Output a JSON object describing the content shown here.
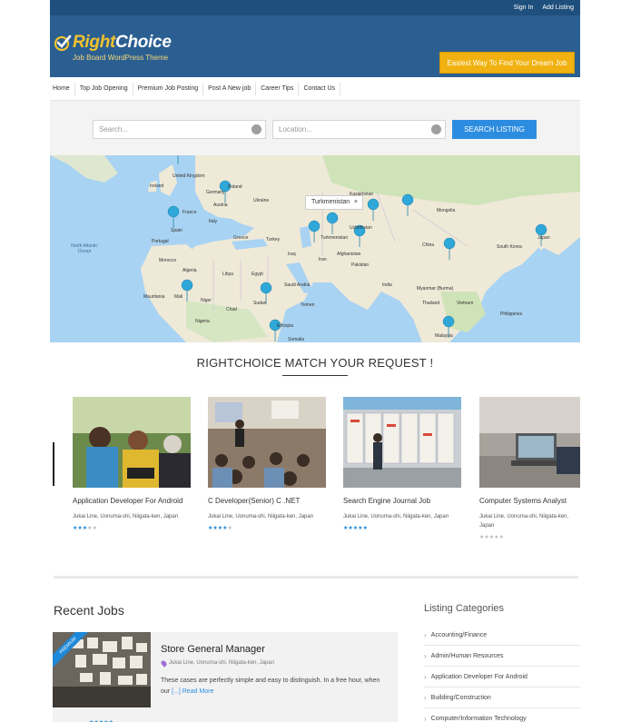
{
  "header": {
    "top_links": [
      "Sign In",
      "Add Listing"
    ],
    "logo_part1": "Right",
    "logo_part2": "Choice",
    "tagline": "Job Board WordPress Theme",
    "cta": "Easiest Way To Find Your Dream Job"
  },
  "nav": {
    "items": [
      "Home",
      "Top Job Opening",
      "Premium Job Posting",
      "Post A New job",
      "Career Tips",
      "Contact Us"
    ]
  },
  "search": {
    "search_placeholder": "Search...",
    "location_placeholder": "Location...",
    "button": "SEARCH LISTING"
  },
  "map": {
    "tooltip": "Turkmenistan",
    "tooltip_close": "×",
    "labels": [
      "United Kingdom",
      "Ireland",
      "Germany",
      "France",
      "Spain",
      "Portugal",
      "Italy",
      "Austria",
      "Poland",
      "Ukraine",
      "Greece",
      "Turkey",
      "Kazakhstan",
      "Mongolia",
      "Uzbekistan",
      "Turkmenistan",
      "Iran",
      "Iraq",
      "Afghanistan",
      "Pakistan",
      "China",
      "India",
      "South Korea",
      "Japan",
      "Morocco",
      "Algeria",
      "Libya",
      "Egypt",
      "Mauritania",
      "Mali",
      "Niger",
      "Chad",
      "Sudan",
      "Saudi Arabia",
      "Yemen",
      "Ethiopia",
      "Nigeria",
      "Somalia",
      "Myanmar (Burma)",
      "Thailand",
      "Vietnam",
      "Philippines",
      "Malaysia",
      "North Atlantic Ocean"
    ],
    "colors": {
      "water": "#a9d3f2",
      "land": "#efe9d8",
      "green": "#cfe3b8",
      "pin": "#2fa7d8"
    }
  },
  "match": {
    "title": "RIGHTCHOICE MATCH YOUR REQUEST !",
    "cards": [
      {
        "title": "Application Developer For Android",
        "location": "Jukai Line, Uonuma-shi, Niigata-ken, Japan",
        "rating": 3
      },
      {
        "title": "C Developer(Senior) C .NET",
        "location": "Jukai Line, Uonuma-shi, Niigata-ken, Japan",
        "rating": 4
      },
      {
        "title": "Search Engine Journal Job",
        "location": "Jukai Line, Uonuma-shi, Niigata-ken, Japan",
        "rating": 5
      },
      {
        "title": "Computer Systems Analyst",
        "location": "Jukai Line, Uonuma-shi, Niigata-ken, Japan",
        "rating": 0
      }
    ]
  },
  "recent": {
    "title": "Recent Jobs",
    "badge": "PREMIUM",
    "job_title": "Store General Manager",
    "job_location": "Jukai Line, Uonuma-shi, Niigata-ken, Japan",
    "job_desc": "These cases are perfectly simple and easy to distinguish. In a free hour, when our",
    "read_more": "[...] Read More",
    "rating": 5
  },
  "categories": {
    "title": "Listing Categories",
    "items": [
      "Accounting/Finance",
      "Admin/Human Resources",
      "Application Developer For Android",
      "Building/Construction",
      "Computer/Information Technology"
    ]
  }
}
